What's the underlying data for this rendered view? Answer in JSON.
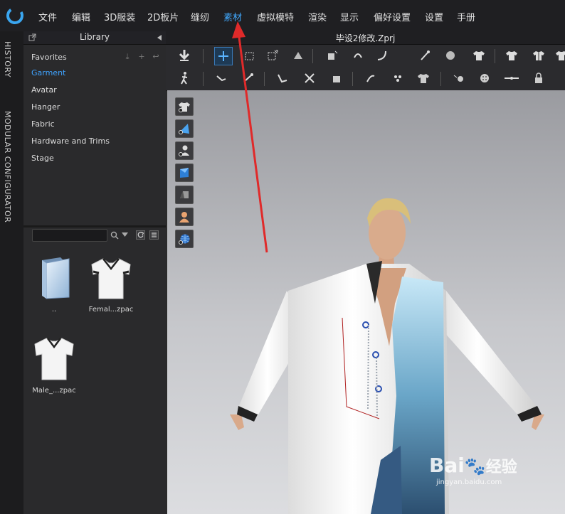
{
  "menu": {
    "items": [
      {
        "label": "文件",
        "active": false
      },
      {
        "label": "编辑",
        "active": false
      },
      {
        "label": "3D服装",
        "active": false
      },
      {
        "label": "2D板片",
        "active": false
      },
      {
        "label": "缝纫",
        "active": false
      },
      {
        "label": "素材",
        "active": true
      },
      {
        "label": "虚拟模特",
        "active": false
      },
      {
        "label": "渲染",
        "active": false
      },
      {
        "label": "显示",
        "active": false
      },
      {
        "label": "偏好设置",
        "active": false
      },
      {
        "label": "设置",
        "active": false
      },
      {
        "label": "手册",
        "active": false
      }
    ]
  },
  "side_tabs": {
    "history": "HISTORY",
    "modular": "MODULAR CONFIGURATOR"
  },
  "library": {
    "title": "Library",
    "favorites": "Favorites",
    "items": [
      "Garment",
      "Avatar",
      "Hanger",
      "Fabric",
      "Hardware and Trims",
      "Stage"
    ],
    "selected": "Garment",
    "files": [
      {
        "label": "..",
        "icon": "folder-icon"
      },
      {
        "label": "Femal...zpac",
        "icon": "garment-female-icon"
      },
      {
        "label": "Male_...zpac",
        "icon": "garment-male-icon"
      }
    ]
  },
  "document": {
    "title": "毕设2修改.Zprj"
  },
  "watermark": {
    "brand": "Bai",
    "brand_cn": "经验",
    "url": "jingyan.baidu.com"
  },
  "colors": {
    "accent": "#41a9ff",
    "arrow": "#e02a2a"
  }
}
